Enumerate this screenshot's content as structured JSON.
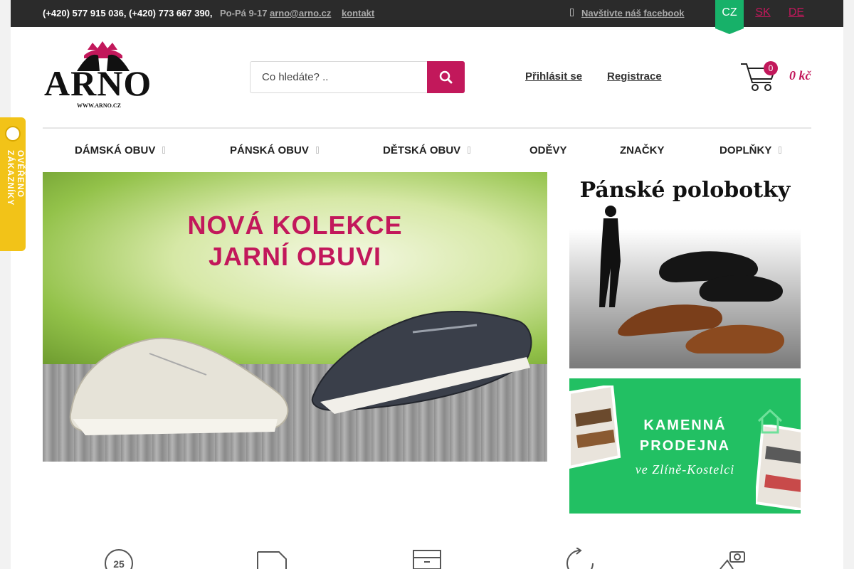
{
  "topbar": {
    "phones": "(+420) 577 915 036, (+420) 773 667 390,",
    "hours": "Po-Pá 9-17",
    "email": "arno@arno.cz",
    "contact": "kontakt",
    "facebook": "Navštivte náš facebook",
    "languages": [
      "CZ",
      "SK",
      "DE"
    ],
    "active_language": "CZ"
  },
  "logo": {
    "name": "ARNO",
    "url_text": "WWW.ARNO.CZ"
  },
  "search": {
    "placeholder": "Co hledáte? .."
  },
  "account": {
    "login": "Přihlásit se",
    "register": "Registrace"
  },
  "cart": {
    "count": "0",
    "total": "0 kč"
  },
  "nav": {
    "items": [
      {
        "label": "DÁMSKÁ OBUV",
        "has_dropdown": true
      },
      {
        "label": "PÁNSKÁ OBUV",
        "has_dropdown": true
      },
      {
        "label": "DĚTSKÁ OBUV",
        "has_dropdown": true
      },
      {
        "label": "ODĚVY",
        "has_dropdown": false
      },
      {
        "label": "ZNAČKY",
        "has_dropdown": false
      },
      {
        "label": "DOPLŇKY",
        "has_dropdown": true
      }
    ]
  },
  "hero": {
    "line1": "NOVÁ KOLEKCE",
    "line2": "JARNÍ OBUVI"
  },
  "promo_men": {
    "title": "Pánské polobotky"
  },
  "promo_store": {
    "line1": "KAMENNÁ",
    "line2": "PRODEJNA",
    "line3": "ve Zlíně-Kostelci"
  },
  "verified_badge": {
    "text": "OVĚŘENO ZÁKAZNÍKY"
  },
  "features": {
    "clock_number": "25"
  },
  "colors": {
    "accent": "#c2185b",
    "green": "#17b169",
    "topbar": "#2b2b2b",
    "badge": "#f2c318"
  }
}
